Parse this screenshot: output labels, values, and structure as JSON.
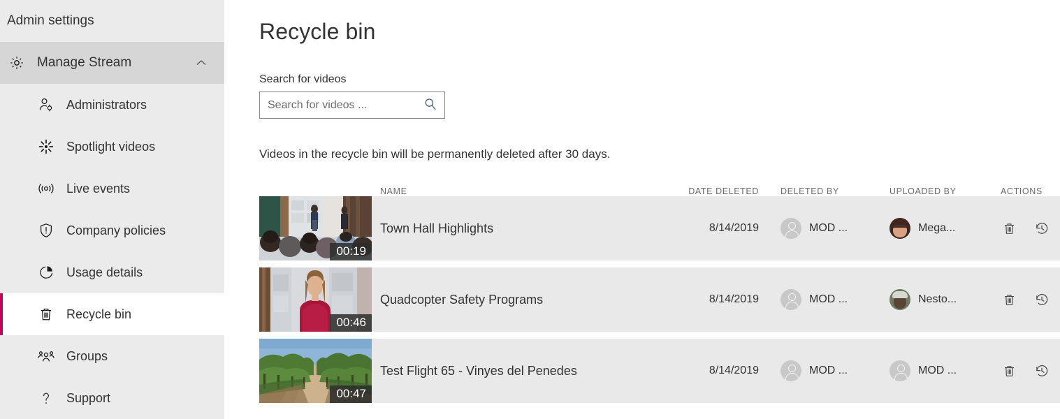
{
  "sidebar": {
    "admin_settings_label": "Admin settings",
    "section": {
      "label": "Manage Stream",
      "icon": "gear-icon",
      "chevron": "chevron-up-icon",
      "expanded": true
    },
    "items": [
      {
        "label": "Administrators",
        "icon": "person-settings-icon",
        "selected": false
      },
      {
        "label": "Spotlight videos",
        "icon": "spotlight-icon",
        "selected": false
      },
      {
        "label": "Live events",
        "icon": "broadcast-icon",
        "selected": false
      },
      {
        "label": "Company policies",
        "icon": "shield-alert-icon",
        "selected": false
      },
      {
        "label": "Usage details",
        "icon": "pie-chart-icon",
        "selected": false
      },
      {
        "label": "Recycle bin",
        "icon": "trash-icon",
        "selected": true
      },
      {
        "label": "Groups",
        "icon": "people-icon",
        "selected": false
      },
      {
        "label": "Support",
        "icon": "question-mark-icon",
        "selected": false
      }
    ],
    "selected_accent_color": "#c4005a",
    "background_color": "#ebebeb",
    "section_background_color": "#d6d6d6"
  },
  "main": {
    "page_title": "Recycle bin",
    "search": {
      "label": "Search for videos",
      "placeholder": "Search for videos ...",
      "value": "",
      "button_icon": "search-icon"
    },
    "notice": "Videos in the recycle bin will be permanently deleted after 30 days.",
    "table": {
      "columns": [
        "",
        "NAME",
        "DATE DELETED",
        "DELETED BY",
        "UPLOADED BY",
        "ACTIONS"
      ],
      "row_background_color": "#e9e9e9",
      "rows": [
        {
          "name": "Town Hall Highlights",
          "duration": "00:19",
          "date_deleted": "8/14/2019",
          "deleted_by": "MOD ...",
          "deleted_by_avatar": "generic",
          "uploaded_by": "Mega...",
          "uploaded_by_avatar": "photo-megan",
          "thumbnail": "town-hall-audience",
          "actions": [
            "delete-permanently-icon",
            "restore-icon"
          ]
        },
        {
          "name": "Quadcopter Safety Programs",
          "duration": "00:46",
          "date_deleted": "8/14/2019",
          "deleted_by": "MOD ...",
          "deleted_by_avatar": "generic",
          "uploaded_by": "Nesto...",
          "uploaded_by_avatar": "photo-nestor",
          "thumbnail": "presenter-red-sweater",
          "actions": [
            "delete-permanently-icon",
            "restore-icon"
          ]
        },
        {
          "name": "Test Flight 65 - Vinyes del Penedes",
          "duration": "00:47",
          "date_deleted": "8/14/2019",
          "deleted_by": "MOD ...",
          "deleted_by_avatar": "generic",
          "uploaded_by": "MOD ...",
          "uploaded_by_avatar": "generic",
          "thumbnail": "vineyard-path",
          "actions": [
            "delete-permanently-icon",
            "restore-icon"
          ]
        }
      ]
    }
  }
}
